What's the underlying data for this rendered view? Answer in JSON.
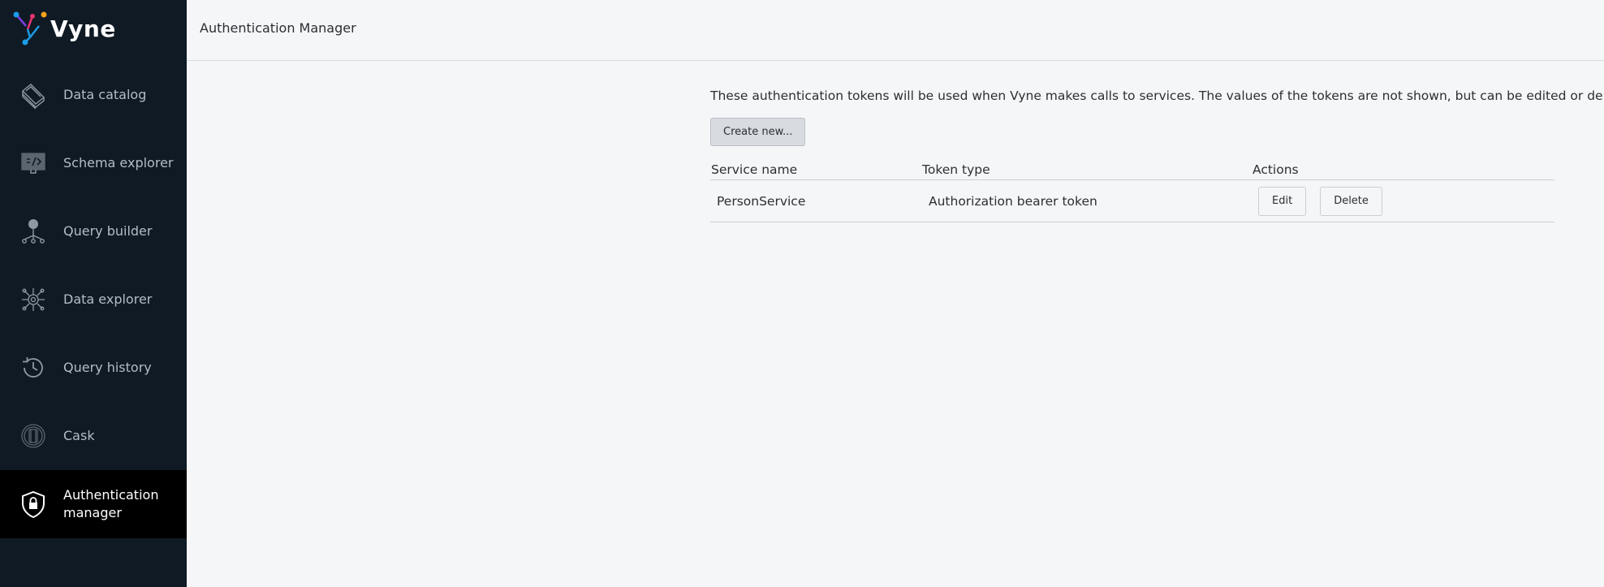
{
  "app": {
    "name": "Vyne"
  },
  "sidebar": {
    "items": [
      {
        "label": "Data catalog",
        "icon": "book-stack-icon",
        "active": false
      },
      {
        "label": "Schema explorer",
        "icon": "monitor-code-icon",
        "active": false
      },
      {
        "label": "Query builder",
        "icon": "question-tree-icon",
        "active": false
      },
      {
        "label": "Data explorer",
        "icon": "network-target-icon",
        "active": false
      },
      {
        "label": "Query history",
        "icon": "history-clock-icon",
        "active": false
      },
      {
        "label": "Cask",
        "icon": "cask-icon",
        "active": false
      },
      {
        "label": "Authentication manager",
        "icon": "shield-lock-icon",
        "active": true
      }
    ]
  },
  "header": {
    "title": "Authentication Manager"
  },
  "main": {
    "description": "These authentication tokens will be used when Vyne makes calls to services. The values of the tokens are not shown, but can be edited or deleted.",
    "create_label": "Create new...",
    "table": {
      "columns": [
        "Service name",
        "Token type",
        "Actions"
      ],
      "rows": [
        {
          "service": "PersonService",
          "token_type": "Authorization bearer token",
          "edit_label": "Edit",
          "delete_label": "Delete"
        }
      ]
    }
  },
  "colors": {
    "sidebar_bg": "#0f1a24",
    "active_bg": "#000000",
    "page_bg": "#f5f6f8"
  }
}
